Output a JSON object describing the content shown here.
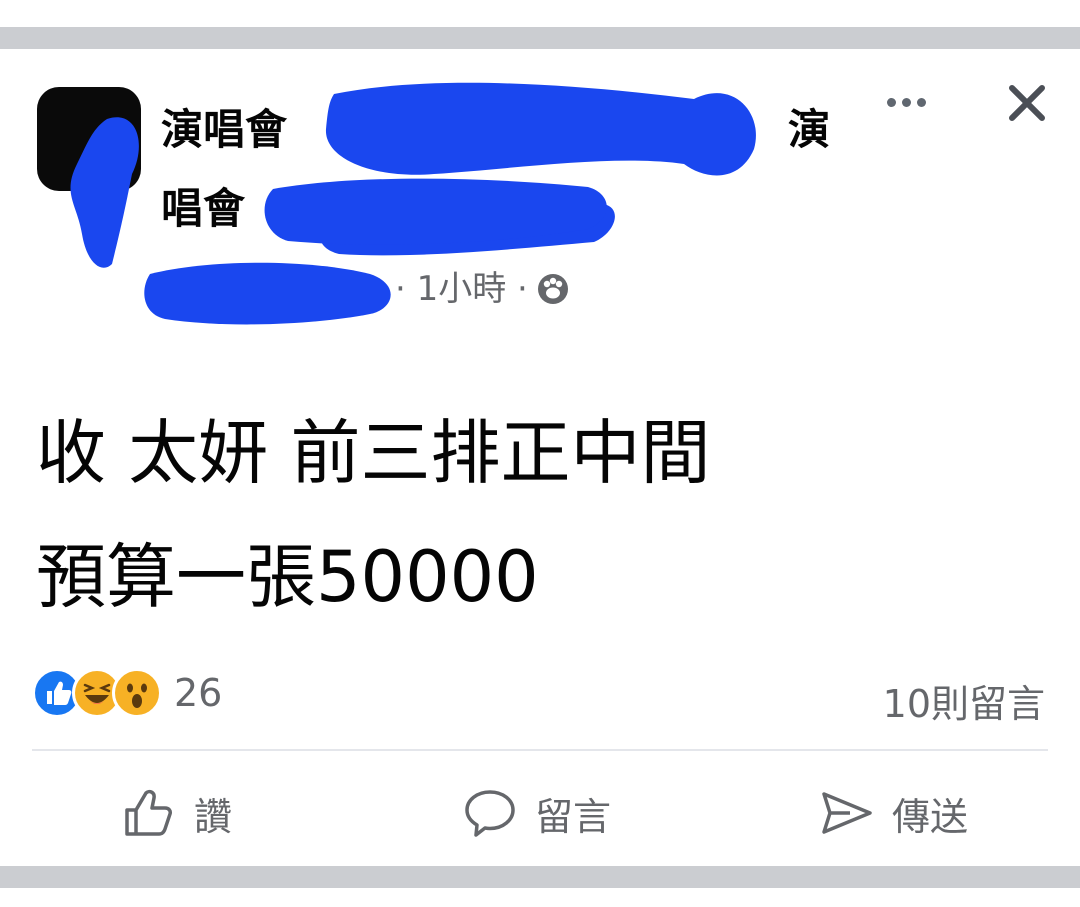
{
  "header": {
    "group_name_line1": "演唱會",
    "group_name_trailing": "演",
    "group_name_line2": "唱會",
    "time": "· 1小時 ·",
    "privacy_icon": "globe-icon",
    "more_icon": "more-icon",
    "close_icon": "close-icon"
  },
  "post": {
    "line1": "收 太妍 前三排正中間",
    "line2": "預算一張50000"
  },
  "engagement": {
    "reactions": [
      "like-icon",
      "haha-icon",
      "wow-icon"
    ],
    "reaction_count": "26",
    "comment_count": "10則留言"
  },
  "actions": {
    "like_label": "讚",
    "comment_label": "留言",
    "share_label": "傳送"
  },
  "colors": {
    "redaction": "#1a47ef",
    "muted_text": "#65676b",
    "like_blue": "#1877f2",
    "emoji_yellow": "#f7b125"
  }
}
